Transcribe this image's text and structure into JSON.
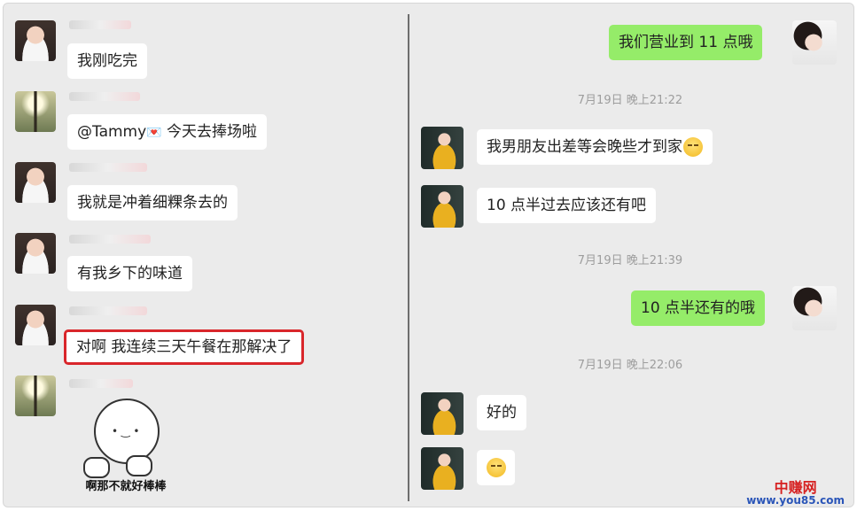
{
  "left_chat": {
    "messages": [
      {
        "text": "我刚吃完",
        "avatar": "girl"
      },
      {
        "text_prefix": "@Tammy",
        "text_icon": "heart-mail-icon",
        "text_suffix": " 今天去捧场啦",
        "avatar": "road"
      },
      {
        "text": "我就是冲着细粿条去的",
        "avatar": "girl"
      },
      {
        "text": "有我乡下的味道",
        "avatar": "girl"
      },
      {
        "text": "对啊 我连续三天午餐在那解决了",
        "avatar": "girl",
        "highlighted": true
      },
      {
        "sticker_caption": "啊那不就好棒棒",
        "avatar": "road"
      }
    ]
  },
  "right_chat": {
    "messages": [
      {
        "text": "我们营业到 11 点哦",
        "side": "me"
      },
      {
        "time": "7月19日 晚上21:22"
      },
      {
        "text": "我男朋友出差等会晚些才到家",
        "emoji": "grimace-face-icon",
        "side": "other"
      },
      {
        "text": "10 点半过去应该还有吧",
        "side": "other"
      },
      {
        "time": "7月19日 晚上21:39"
      },
      {
        "text": "10 点半还有的哦",
        "side": "me"
      },
      {
        "time": "7月19日 晚上22:06"
      },
      {
        "text": "好的",
        "side": "other"
      },
      {
        "emoji": "smirk-face-icon",
        "side": "other"
      }
    ]
  },
  "watermark": {
    "title": "中赚网",
    "url": "www.you85.com"
  },
  "colors": {
    "self_bubble": "#95ec69",
    "other_bubble": "#ffffff",
    "highlight_border": "#d9262b",
    "background": "#ebebeb"
  }
}
